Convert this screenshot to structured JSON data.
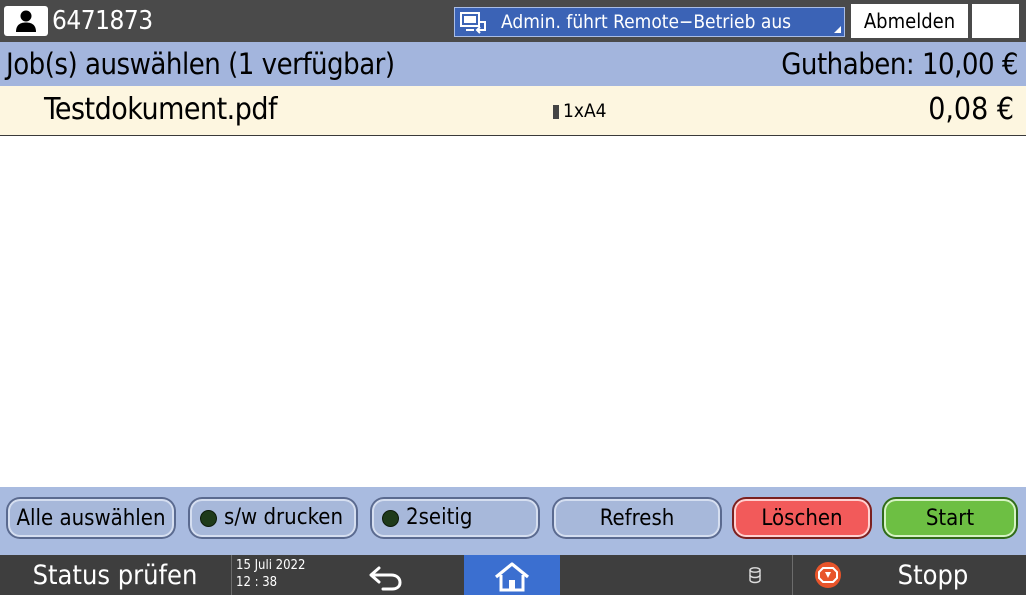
{
  "topbar": {
    "user_icon": "user-icon",
    "user_id": "6471873",
    "remote_icon": "remote-operation-icon",
    "remote_status": "Admin. führt Remote−Betrieb aus",
    "logout_label": "Abmelden",
    "night_icon": "moon-icon"
  },
  "header": {
    "title": "Job(s) auswählen (1 verfügbar)",
    "balance": "Guthaben: 10,00 €"
  },
  "jobs": [
    {
      "name": "Testdokument.pdf",
      "paper_icon": "bw-toner-icon",
      "paper": "1xA4",
      "price": "0,08 €"
    }
  ],
  "buttons": {
    "select_all": "Alle auswählen",
    "bw_print": "s/w drucken",
    "duplex": "2seitig",
    "refresh": "Refresh",
    "delete": "Löschen",
    "start": "Start"
  },
  "statusbar": {
    "status_label": "Status prüfen",
    "date": "15 Juli 2022",
    "time": "12 : 38",
    "back_icon": "back-arrow-icon",
    "home_icon": "home-icon",
    "data_icon": "database-icon",
    "stop_icon": "stop-icon",
    "stop_label": "Stopp"
  },
  "colors": {
    "topbar": "#4a4a4a",
    "header": "#a3b5dd",
    "job_row": "#fdf6e0",
    "remote_banner": "#3b63b6",
    "delete_button": "#f25a5a",
    "start_button": "#6dbf43",
    "home_button": "#3b6fd0"
  }
}
